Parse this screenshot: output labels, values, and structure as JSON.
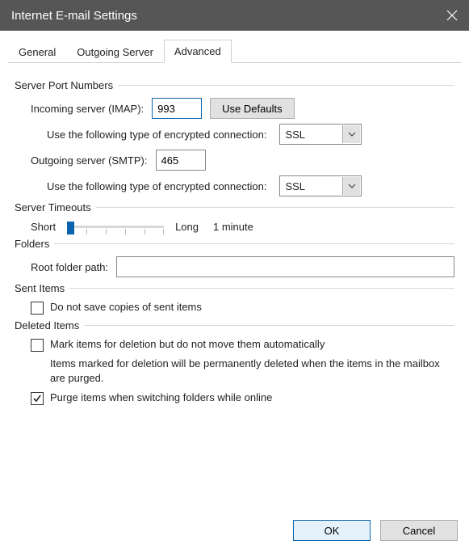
{
  "window": {
    "title": "Internet E-mail Settings"
  },
  "tabs": {
    "general": "General",
    "outgoing": "Outgoing Server",
    "advanced": "Advanced"
  },
  "groups": {
    "portNumbers": "Server Port Numbers",
    "timeouts": "Server Timeouts",
    "folders": "Folders",
    "sentItems": "Sent Items",
    "deletedItems": "Deleted Items"
  },
  "ports": {
    "incomingLabel": "Incoming server (IMAP):",
    "incomingValue": "993",
    "useDefaults": "Use Defaults",
    "encIncomingLabel": "Use the following type of encrypted connection:",
    "encIncomingValue": "SSL",
    "outgoingLabel": "Outgoing server (SMTP):",
    "outgoingValue": "465",
    "encOutgoingLabel": "Use the following type of encrypted connection:",
    "encOutgoingValue": "SSL"
  },
  "timeouts": {
    "short": "Short",
    "long": "Long",
    "value": "1 minute"
  },
  "folders": {
    "rootLabel": "Root folder path:",
    "rootValue": ""
  },
  "sentItems": {
    "doNotSave": "Do not save copies of sent items",
    "doNotSaveChecked": false
  },
  "deletedItems": {
    "markForDeletion": "Mark items for deletion but do not move them automatically",
    "markForDeletionChecked": false,
    "hint": "Items marked for deletion will be permanently deleted when the items in the mailbox are purged.",
    "purge": "Purge items when switching folders while online",
    "purgeChecked": true
  },
  "buttons": {
    "ok": "OK",
    "cancel": "Cancel"
  }
}
